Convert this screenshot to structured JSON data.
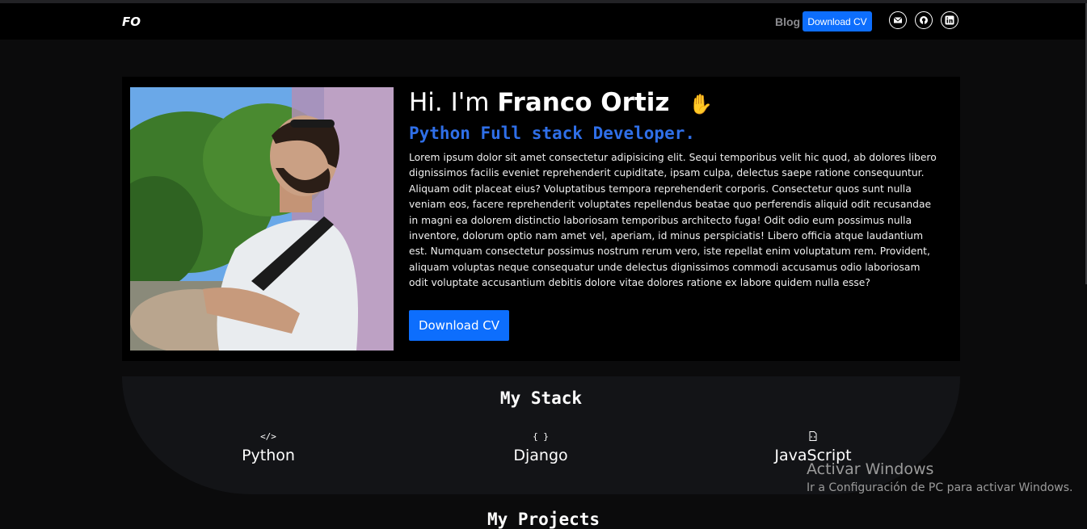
{
  "nav": {
    "brand": "FO",
    "blog_label": "Blog",
    "download_label": "Download CV",
    "icons": [
      "mail-icon",
      "github-icon",
      "linkedin-icon"
    ]
  },
  "hero": {
    "greeting": "Hi. I'm",
    "name": "Franco Ortiz",
    "wave_emoji": "✋",
    "subtitle": "Python Full stack Developer.",
    "bio": "Lorem ipsum dolor sit amet consectetur adipisicing elit. Sequi temporibus velit hic quod, ab dolores libero dignissimos facilis eveniet reprehenderit cupiditate, ipsam culpa, delectus saepe ratione consequuntur. Aliquam odit placeat eius? Voluptatibus tempora reprehenderit corporis. Consectetur quos sunt nulla veniam eos, facere reprehenderit voluptates repellendus beatae quo perferendis aliquid odit recusandae in magni ea dolorem distinctio laboriosam temporibus architecto fuga! Odit odio eum possimus nulla inventore, dolorum optio nam amet vel, aperiam, id minus perspiciatis! Libero officia atque laudantium est. Numquam consectetur possimus nostrum rerum vero, iste repellat enim voluptatum rem. Provident, aliquam voluptas neque consequatur unde delectus dignissimos commodi accusamus odio laboriosam odit voluptate accusantium debitis dolore vitae dolores ratione ex labore quidem nulla esse?",
    "button_label": "Download CV"
  },
  "stack": {
    "title": "My Stack",
    "items": [
      {
        "label": "Python",
        "icon_glyph": "</>",
        "icon": "code-icon"
      },
      {
        "label": "Django",
        "icon_glyph": "{ }",
        "icon": "braces-icon"
      },
      {
        "label": "JavaScript",
        "icon_glyph": "📄",
        "icon": "file-code-icon"
      }
    ]
  },
  "projects": {
    "title": "My Projects"
  },
  "watermark": {
    "title": "Activar Windows",
    "subtitle": "Ir a Configuración de PC para activar Windows."
  },
  "colors": {
    "accent": "#0d6efd",
    "subtitle": "#2f6fe8",
    "background": "#0b0b0c",
    "panel": "#000000",
    "stack_bg": "#131417"
  }
}
